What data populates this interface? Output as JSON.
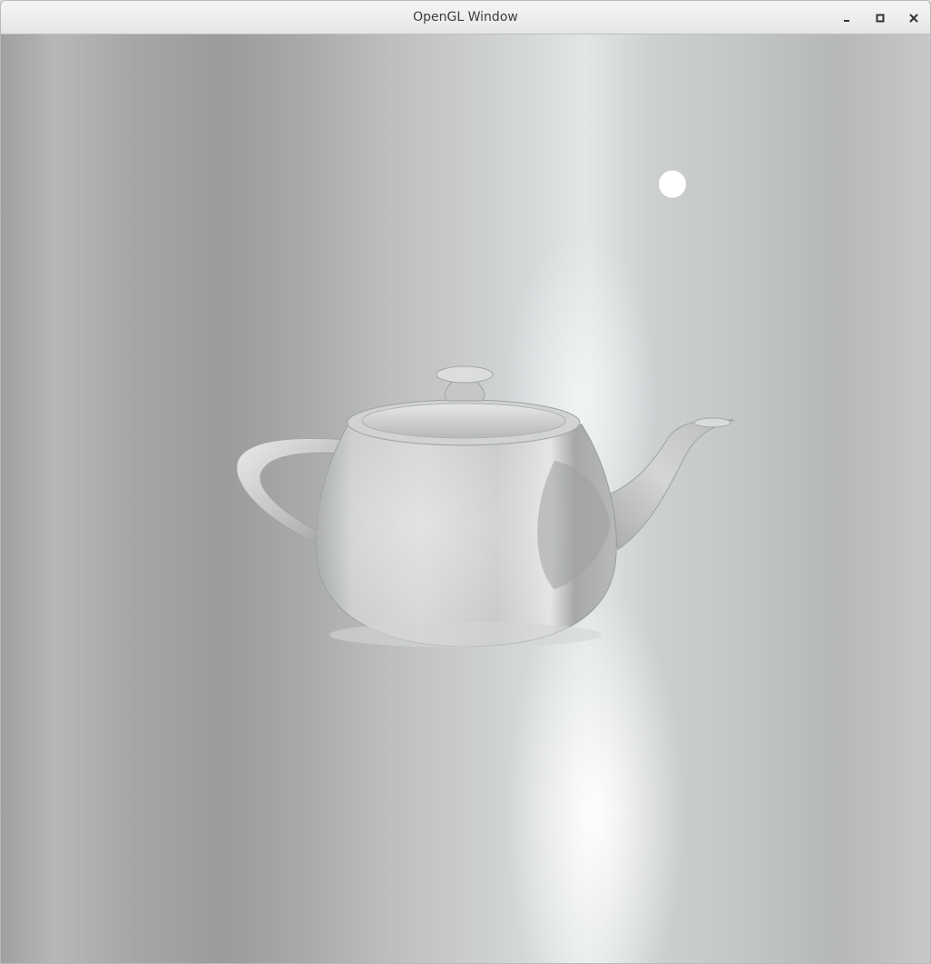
{
  "window": {
    "title": "OpenGL Window"
  },
  "controls": {
    "minimize": "minimize-icon",
    "maximize": "maximize-icon",
    "close": "close-icon"
  },
  "scene": {
    "object": "teapot",
    "light": "light-sphere",
    "colors": {
      "background_light": "#e2e6e6",
      "background_dark": "#9a9b9d",
      "teapot_base": "#c4c6c6",
      "light": "#ffffff"
    }
  }
}
